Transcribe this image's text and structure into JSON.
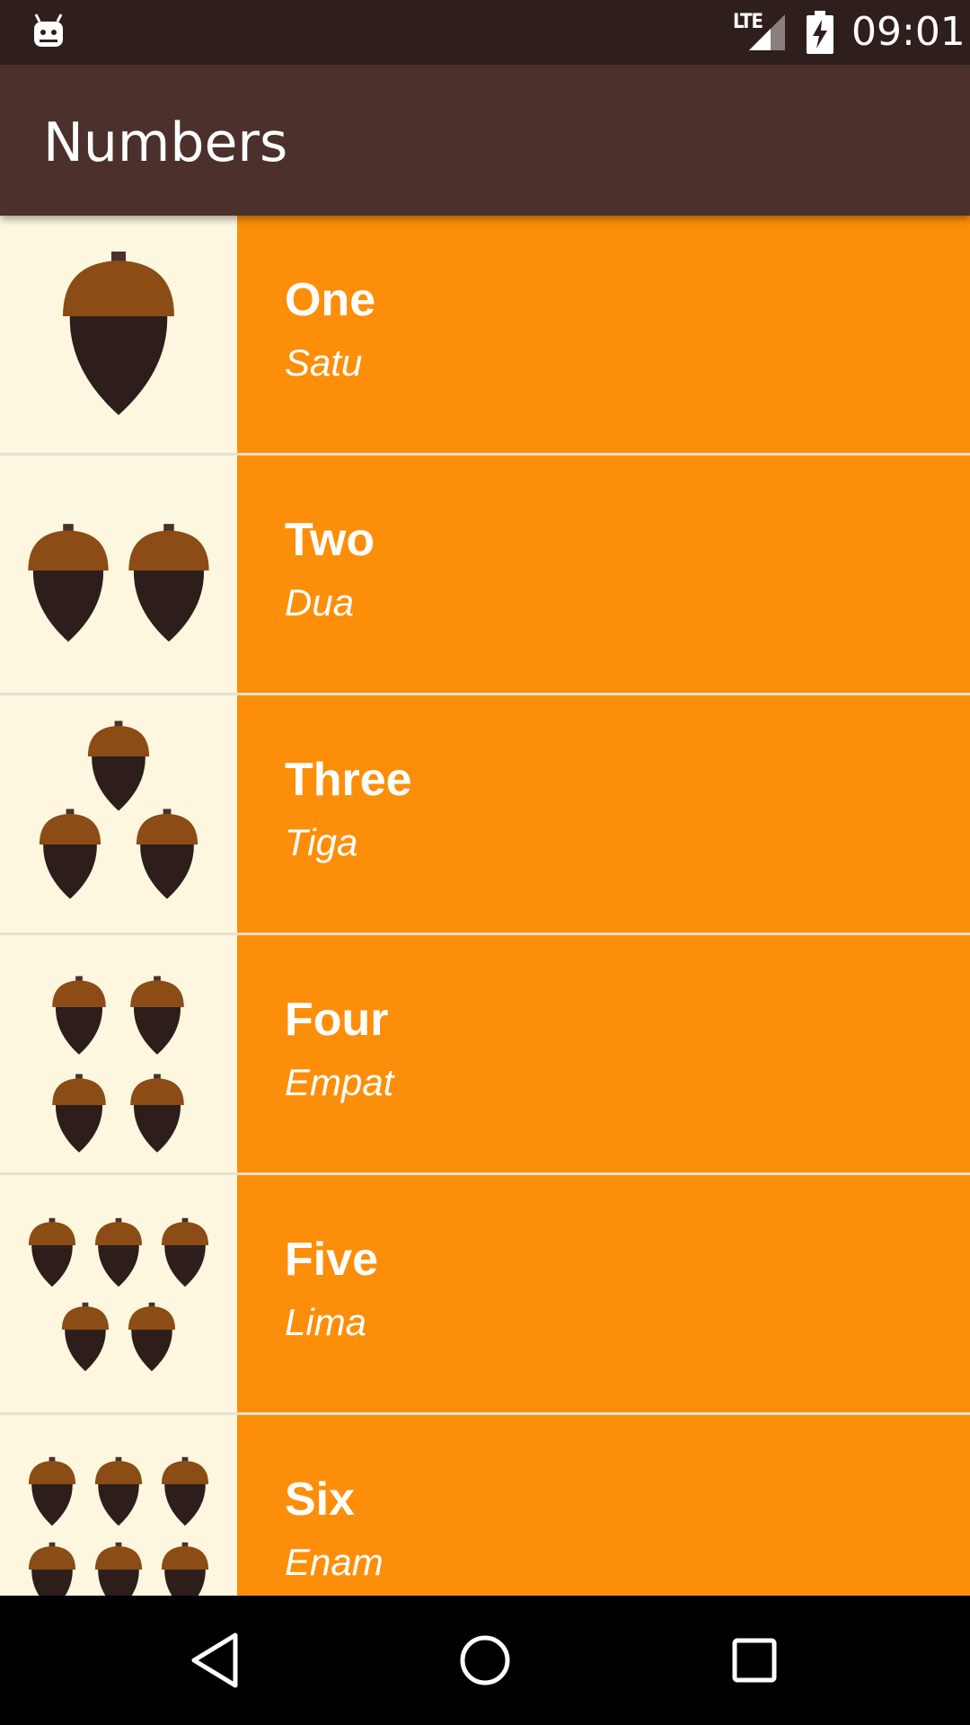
{
  "status_bar": {
    "network": "LTE",
    "time": "09:01"
  },
  "app_bar": {
    "title": "Numbers"
  },
  "colors": {
    "status_bar": "#2f1f1c",
    "app_bar": "#4b302b",
    "row_text_bg": "#fd8e09",
    "row_image_bg": "#fdf7df",
    "acorn_cap": "#8b4c15",
    "acorn_body": "#2e1e1b"
  },
  "list": {
    "items": [
      {
        "english": "One",
        "translation": "Satu",
        "count": 1
      },
      {
        "english": "Two",
        "translation": "Dua",
        "count": 2
      },
      {
        "english": "Three",
        "translation": "Tiga",
        "count": 3
      },
      {
        "english": "Four",
        "translation": "Empat",
        "count": 4
      },
      {
        "english": "Five",
        "translation": "Lima",
        "count": 5
      },
      {
        "english": "Six",
        "translation": "Enam",
        "count": 6
      }
    ]
  },
  "nav_bar": {
    "icons": [
      "back-icon",
      "home-icon",
      "recents-icon"
    ]
  }
}
